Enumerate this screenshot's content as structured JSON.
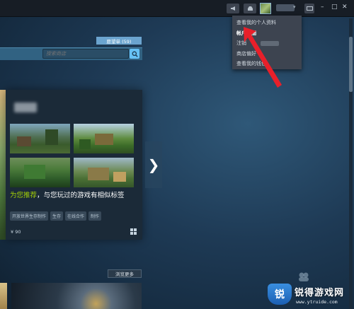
{
  "topbar": {
    "announce_icon": "megaphone-icon",
    "notify_icon": "inbox-icon",
    "screen_icon": "monitor-icon",
    "minimize": "–",
    "maximize": "□",
    "close": "✕",
    "caret": "▾"
  },
  "account_menu": {
    "items": [
      {
        "label": "查看我的个人资料"
      },
      {
        "label": "帐户明细"
      },
      {
        "label": "注销"
      },
      {
        "label": "商店偏好"
      },
      {
        "label": "查看我的钱包"
      }
    ]
  },
  "store": {
    "wishlist_label": "愿望单 (59)",
    "search_placeholder": "搜索商店",
    "recommendation": {
      "title_highlight": "为您推荐",
      "title_rest": "，与您玩过的游戏有相似标签",
      "tags": [
        "开放世界生存制作",
        "生存",
        "在线合作",
        "制作"
      ],
      "price": "¥ 90"
    },
    "next_arrow": "❯",
    "browse_more_label": "浏览更多"
  },
  "watermark": {
    "brand": "锐得游戏网",
    "url": "www.ytruide.com",
    "glyph": "锐"
  },
  "colors": {
    "accent": "#67c1f5",
    "highlight_green": "#a4d007",
    "arrow_red": "#e8202a"
  }
}
